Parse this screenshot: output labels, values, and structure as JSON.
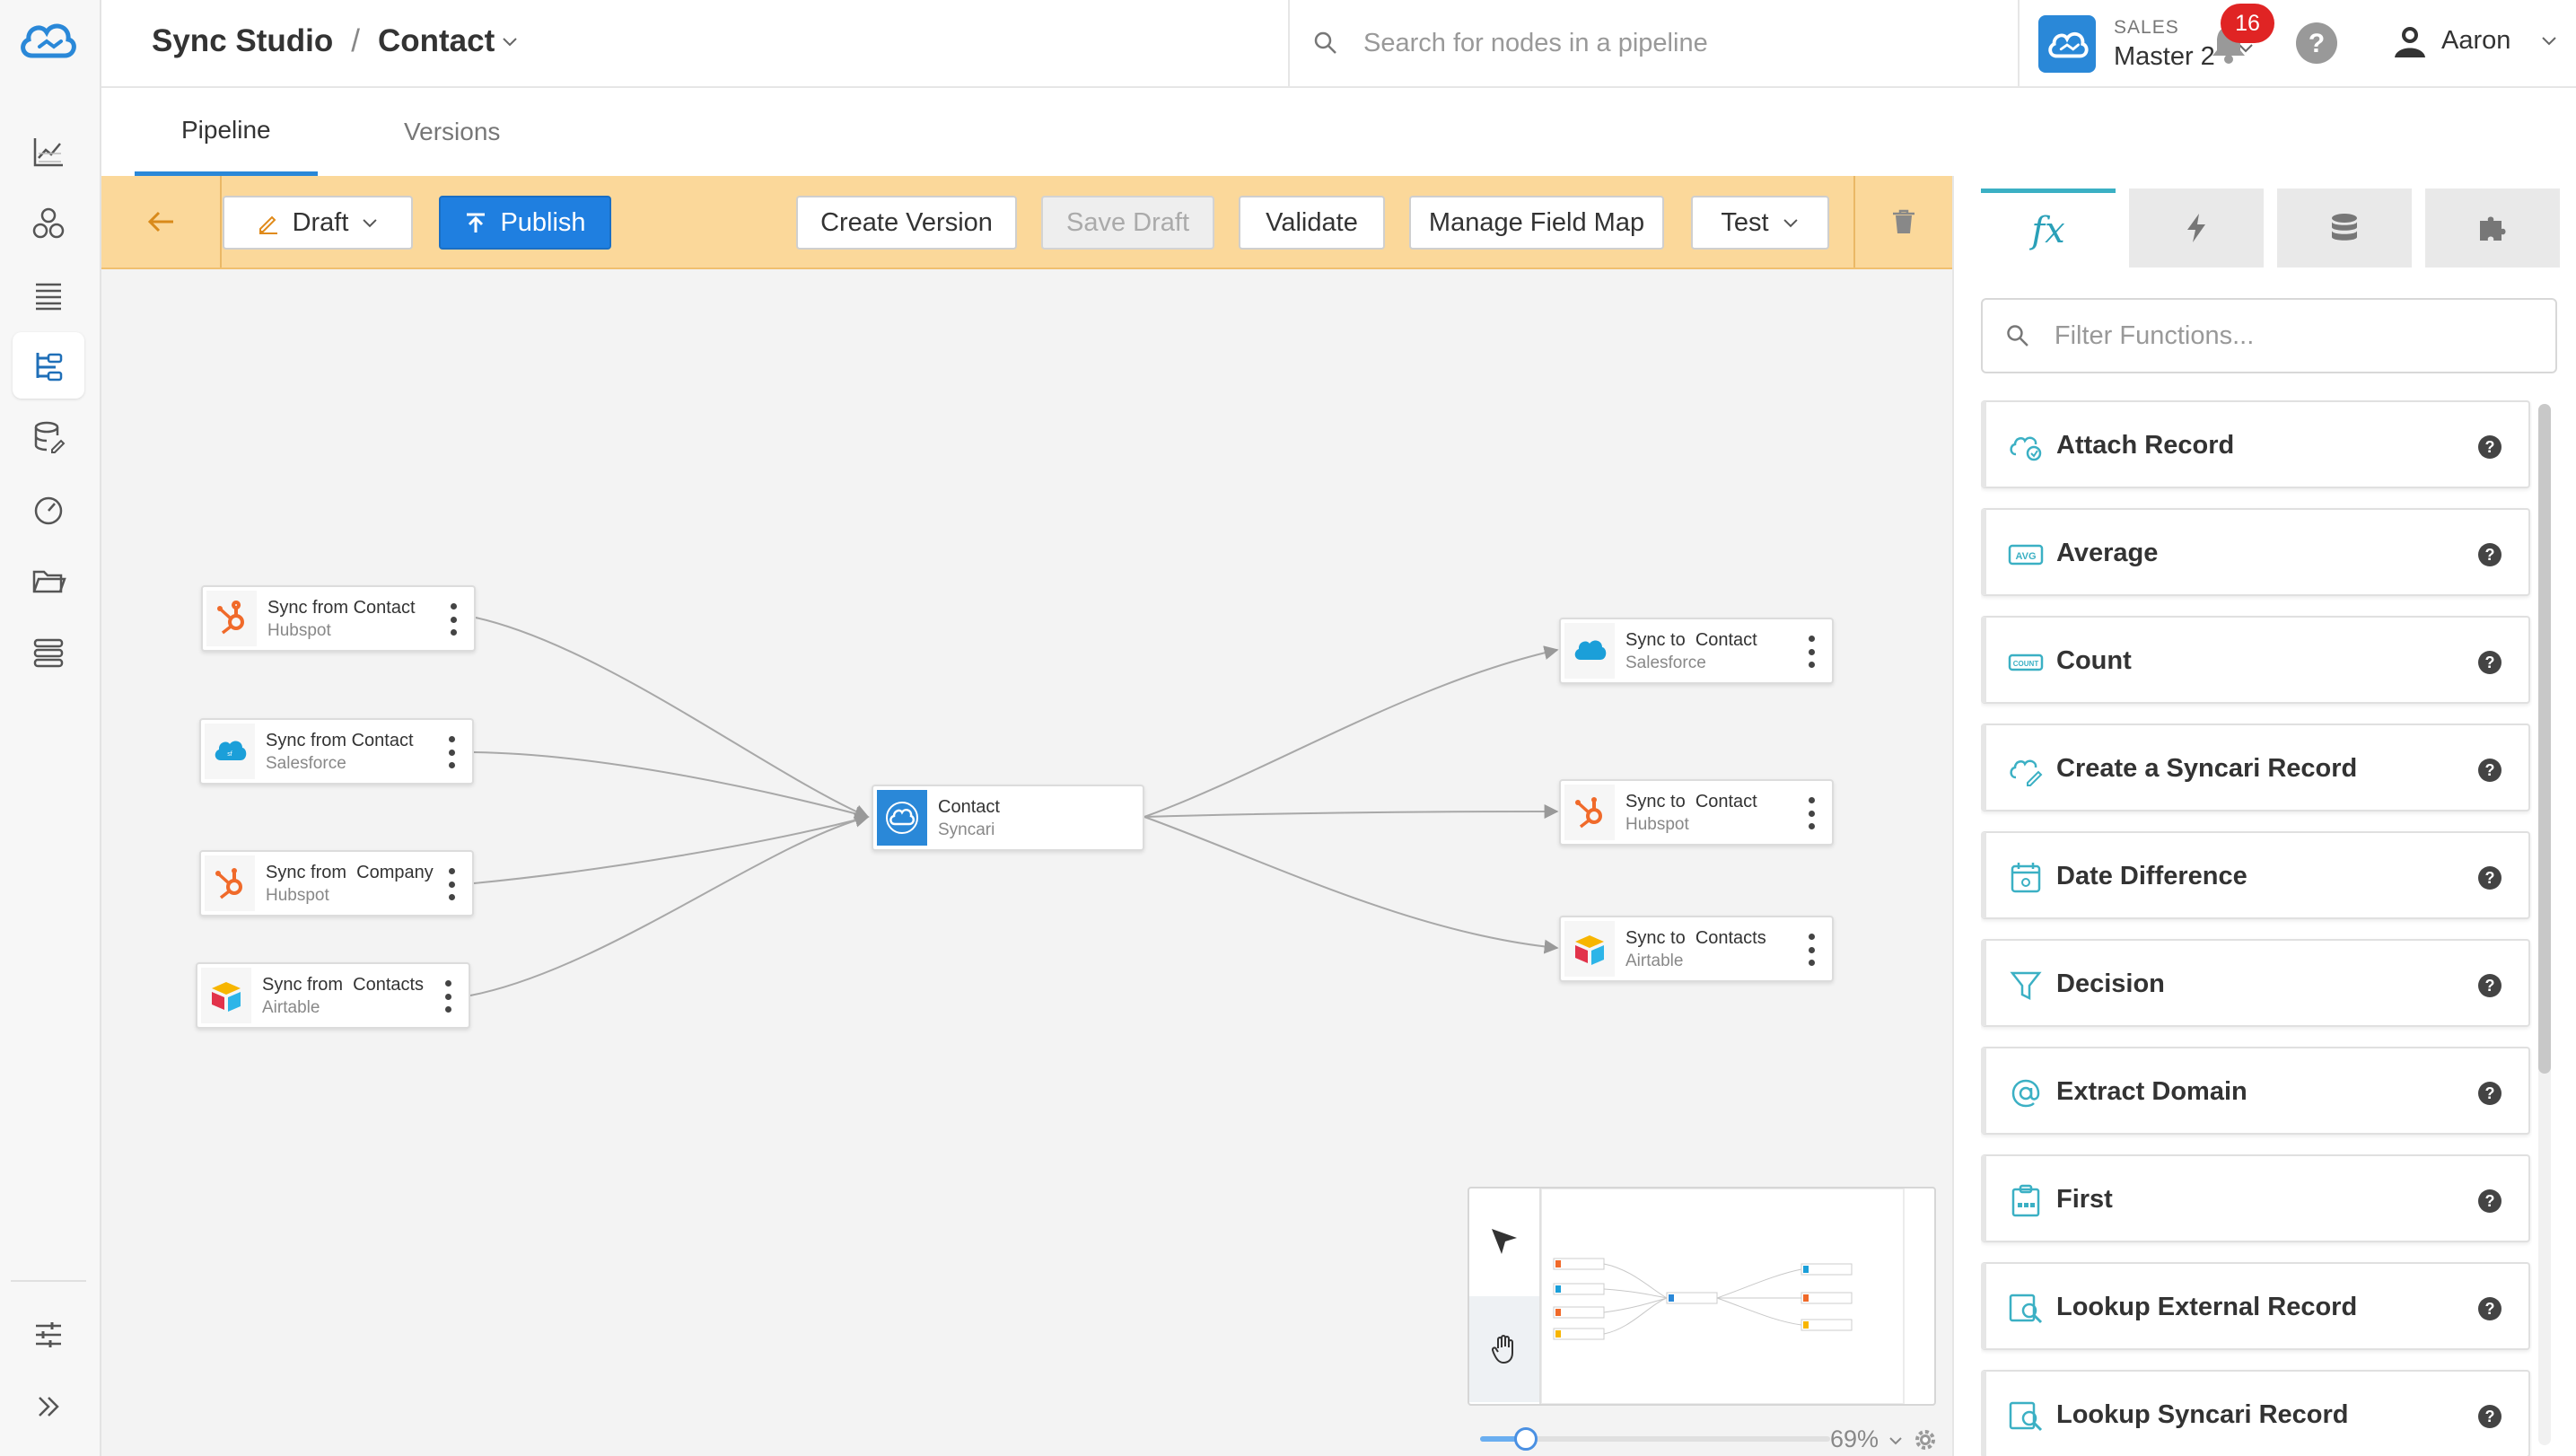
{
  "app": {
    "breadcrumb_root": "Sync Studio",
    "breadcrumb_sep": "/",
    "breadcrumb_current": "Contact"
  },
  "search": {
    "placeholder": "Search for nodes in a pipeline"
  },
  "env": {
    "label": "SALES",
    "name": "Master 2"
  },
  "notifications": {
    "count": "16"
  },
  "user": {
    "name": "Aaron"
  },
  "tabs": [
    {
      "label": "Pipeline",
      "active": true
    },
    {
      "label": "Versions",
      "active": false
    }
  ],
  "toolbar": {
    "draft": "Draft",
    "publish": "Publish",
    "create_version": "Create Version",
    "save_draft": "Save Draft",
    "validate": "Validate",
    "manage_field_map": "Manage Field Map",
    "test": "Test"
  },
  "nodes": {
    "sources": [
      {
        "title": "Sync from Contact",
        "sub": "Hubspot",
        "icon": "hubspot-icon"
      },
      {
        "title": "Sync from Contact",
        "sub": "Salesforce",
        "icon": "salesforce-icon"
      },
      {
        "title": "Sync from  Company",
        "sub": "Hubspot",
        "icon": "hubspot-icon"
      },
      {
        "title": "Sync from  Contacts",
        "sub": "Airtable",
        "icon": "airtable-icon"
      }
    ],
    "center": {
      "title": "Contact",
      "sub": "Syncari",
      "icon": "syncari-icon"
    },
    "targets": [
      {
        "title": "Sync to  Contact",
        "sub": "Salesforce",
        "icon": "salesforce-icon"
      },
      {
        "title": "Sync to  Contact",
        "sub": "Hubspot",
        "icon": "hubspot-icon"
      },
      {
        "title": "Sync to  Contacts",
        "sub": "Airtable",
        "icon": "airtable-icon"
      }
    ]
  },
  "zoom": {
    "level": "69%",
    "fraction": 0.13
  },
  "functions": {
    "filter_placeholder": "Filter Functions...",
    "help_glyph": "?",
    "items": [
      {
        "label": "Attach Record",
        "icon": "attach-record-icon"
      },
      {
        "label": "Average",
        "icon": "avg-icon"
      },
      {
        "label": "Count",
        "icon": "count-icon"
      },
      {
        "label": "Create a Syncari Record",
        "icon": "create-record-icon"
      },
      {
        "label": "Date Difference",
        "icon": "calendar-icon"
      },
      {
        "label": "Decision",
        "icon": "funnel-icon"
      },
      {
        "label": "Extract Domain",
        "icon": "at-icon"
      },
      {
        "label": "First",
        "icon": "clipboard-icon"
      },
      {
        "label": "Lookup External Record",
        "icon": "lookup-icon"
      },
      {
        "label": "Lookup Syncari Record",
        "icon": "lookup-icon"
      }
    ]
  },
  "colors": {
    "accent": "#2a88d8",
    "toolbar_bg": "#fbd89a",
    "publish": "#1f7fe0",
    "badge": "#e02424",
    "fx_tab": "#3bb0c4"
  }
}
